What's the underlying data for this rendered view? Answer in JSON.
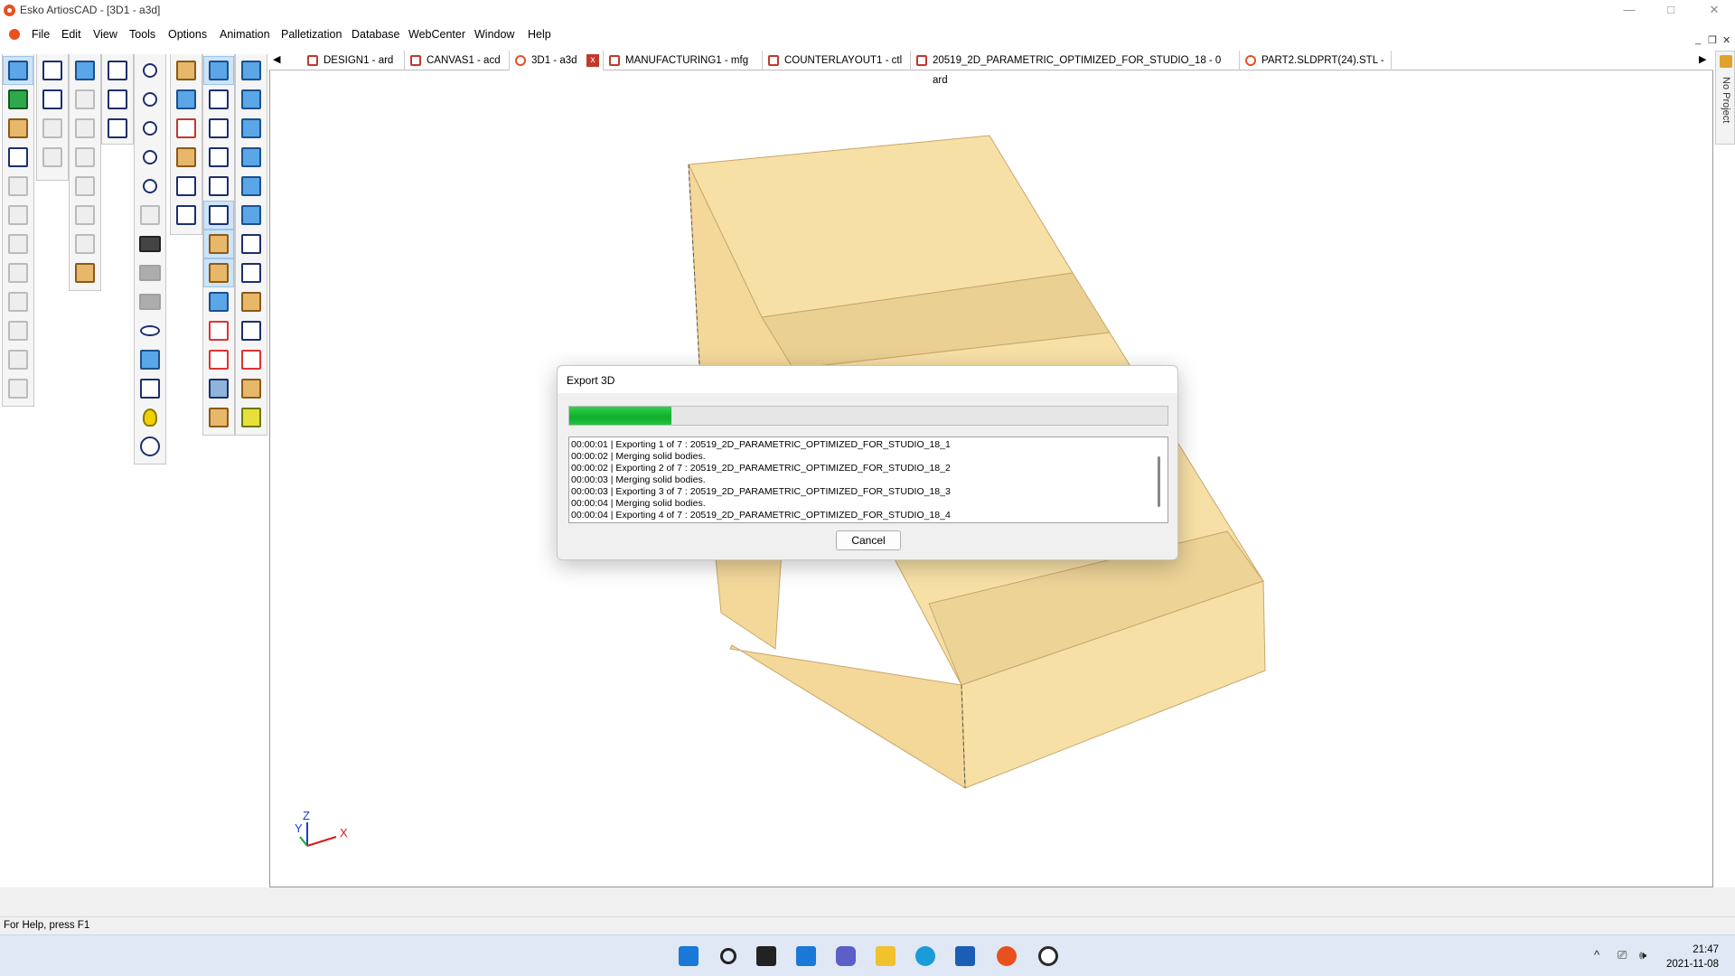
{
  "window": {
    "title": "Esko ArtiosCAD - [3D1 - a3d]",
    "controls": [
      "—",
      "□",
      "✕"
    ],
    "mdi_controls": [
      "_",
      "❐",
      "✕"
    ]
  },
  "menu": {
    "items": [
      "File",
      "Edit",
      "View",
      "Tools",
      "Options",
      "Animation",
      "Palletization",
      "Database",
      "WebCenter",
      "Window",
      "Help"
    ]
  },
  "tabs": [
    {
      "label": "DESIGN1 - ard"
    },
    {
      "label": "CANVAS1 - acd"
    },
    {
      "label": "3D1 - a3d",
      "active": true
    },
    {
      "label": "MANUFACTURING1 - mfg"
    },
    {
      "label": "COUNTERLAYOUT1 - ctl"
    },
    {
      "label": "20519_2D_PARAMETRIC_OPTIMIZED_FOR_STUDIO_18 - 0 ard"
    },
    {
      "label": "PART2.SLDPRT(24).STL -"
    }
  ],
  "tab_nav": {
    "left": "◀",
    "right": "▶",
    "close": "x"
  },
  "side_panel": {
    "label": "No Project"
  },
  "dialog": {
    "title": "Export 3D",
    "progress": 0.17,
    "log": [
      "00:00:01 | Exporting 1 of 7 : 20519_2D_PARAMETRIC_OPTIMIZED_FOR_STUDIO_18_1",
      "00:00:02 | Merging solid bodies.",
      "00:00:02 | Exporting 2 of 7 : 20519_2D_PARAMETRIC_OPTIMIZED_FOR_STUDIO_18_2",
      "00:00:03 | Merging solid bodies.",
      "00:00:03 | Exporting 3 of 7 : 20519_2D_PARAMETRIC_OPTIMIZED_FOR_STUDIO_18_3",
      "00:00:04 | Merging solid bodies.",
      "00:00:04 | Exporting 4 of 7 : 20519_2D_PARAMETRIC_OPTIMIZED_FOR_STUDIO_18_4"
    ],
    "cancel_label": "Cancel"
  },
  "axes": {
    "z": "Z",
    "y": "Y",
    "x": "X"
  },
  "status": {
    "help": "For Help, press F1"
  },
  "clock": {
    "time": "21:47",
    "date": "2021-11-08"
  },
  "tray": {
    "chevron": "^",
    "network": "⎚",
    "volume": "🕪"
  },
  "colors": {
    "box": "#f7e0a6",
    "accent": "#e8501e",
    "progress": "#13b534"
  }
}
